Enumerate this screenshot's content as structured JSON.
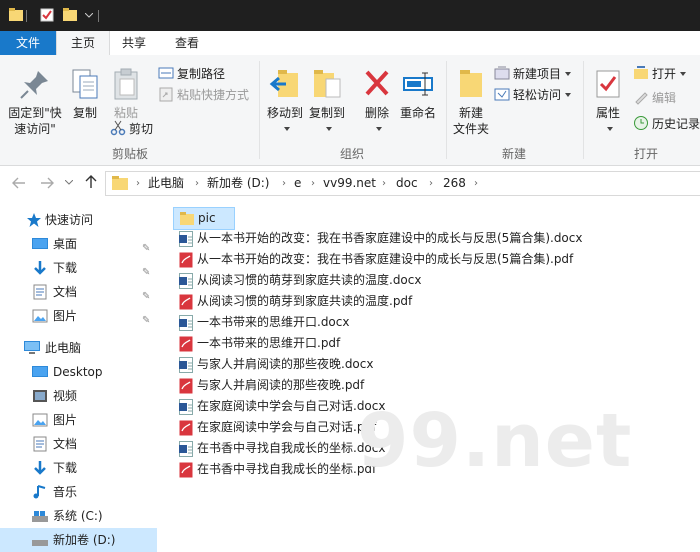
{
  "ribbon_tabs": {
    "file": "文件",
    "home": "主页",
    "share": "共享",
    "view": "查看"
  },
  "clipboard": {
    "pin_quick_access": "固定到\"快速访问\"",
    "copy": "复制",
    "paste": "粘贴",
    "copy_path": "复制路径",
    "paste_shortcut": "粘贴快捷方式",
    "cut": "剪切",
    "group_label": "剪贴板"
  },
  "organize": {
    "move_to": "移动到",
    "copy_to": "复制到",
    "delete": "删除",
    "rename": "重命名",
    "group_label": "组织"
  },
  "new": {
    "new_folder": "新建\n文件夹",
    "new_item": "新建项目",
    "easy_access": "轻松访问",
    "group_label": "新建"
  },
  "open": {
    "properties": "属性",
    "open": "打开",
    "edit": "编辑",
    "history": "历史记录",
    "group_label": "打开"
  },
  "breadcrumb": [
    "此电脑",
    "新加卷 (D:)",
    "e",
    "vv99.net",
    "doc",
    "268"
  ],
  "nav_pane": {
    "quick_access": "快速访问",
    "quick_items": [
      "桌面",
      "下载",
      "文档",
      "图片"
    ],
    "this_pc": "此电脑",
    "pc_items": [
      "Desktop",
      "视频",
      "图片",
      "文档",
      "下载",
      "音乐",
      "系统 (C:)",
      "新加卷 (D:)"
    ]
  },
  "files": [
    {
      "name": "pic",
      "type": "folder"
    },
    {
      "name": "从一本书开始的改变：我在书香家庭建设中的成长与反思(5篇合集).docx",
      "type": "docx"
    },
    {
      "name": "从一本书开始的改变：我在书香家庭建设中的成长与反思(5篇合集).pdf",
      "type": "pdf"
    },
    {
      "name": "从阅读习惯的萌芽到家庭共读的温度.docx",
      "type": "docx"
    },
    {
      "name": "从阅读习惯的萌芽到家庭共读的温度.pdf",
      "type": "pdf"
    },
    {
      "name": "一本书带来的思维开口.docx",
      "type": "docx"
    },
    {
      "name": "一本书带来的思维开口.pdf",
      "type": "pdf"
    },
    {
      "name": "与家人并肩阅读的那些夜晚.docx",
      "type": "docx"
    },
    {
      "name": "与家人并肩阅读的那些夜晚.pdf",
      "type": "pdf"
    },
    {
      "name": "在家庭阅读中学会与自己对话.docx",
      "type": "docx"
    },
    {
      "name": "在家庭阅读中学会与自己对话.pdf",
      "type": "pdf"
    },
    {
      "name": "在书香中寻找自我成长的坐标.docx",
      "type": "docx"
    },
    {
      "name": "在书香中寻找自我成长的坐标.pdf",
      "type": "pdf"
    }
  ],
  "watermark": "99.net",
  "colors": {
    "accent": "#1979ca",
    "folder": "#f8d775",
    "pdf_red": "#d9363e",
    "word_blue": "#2b5797",
    "selection": "#cce8ff"
  }
}
